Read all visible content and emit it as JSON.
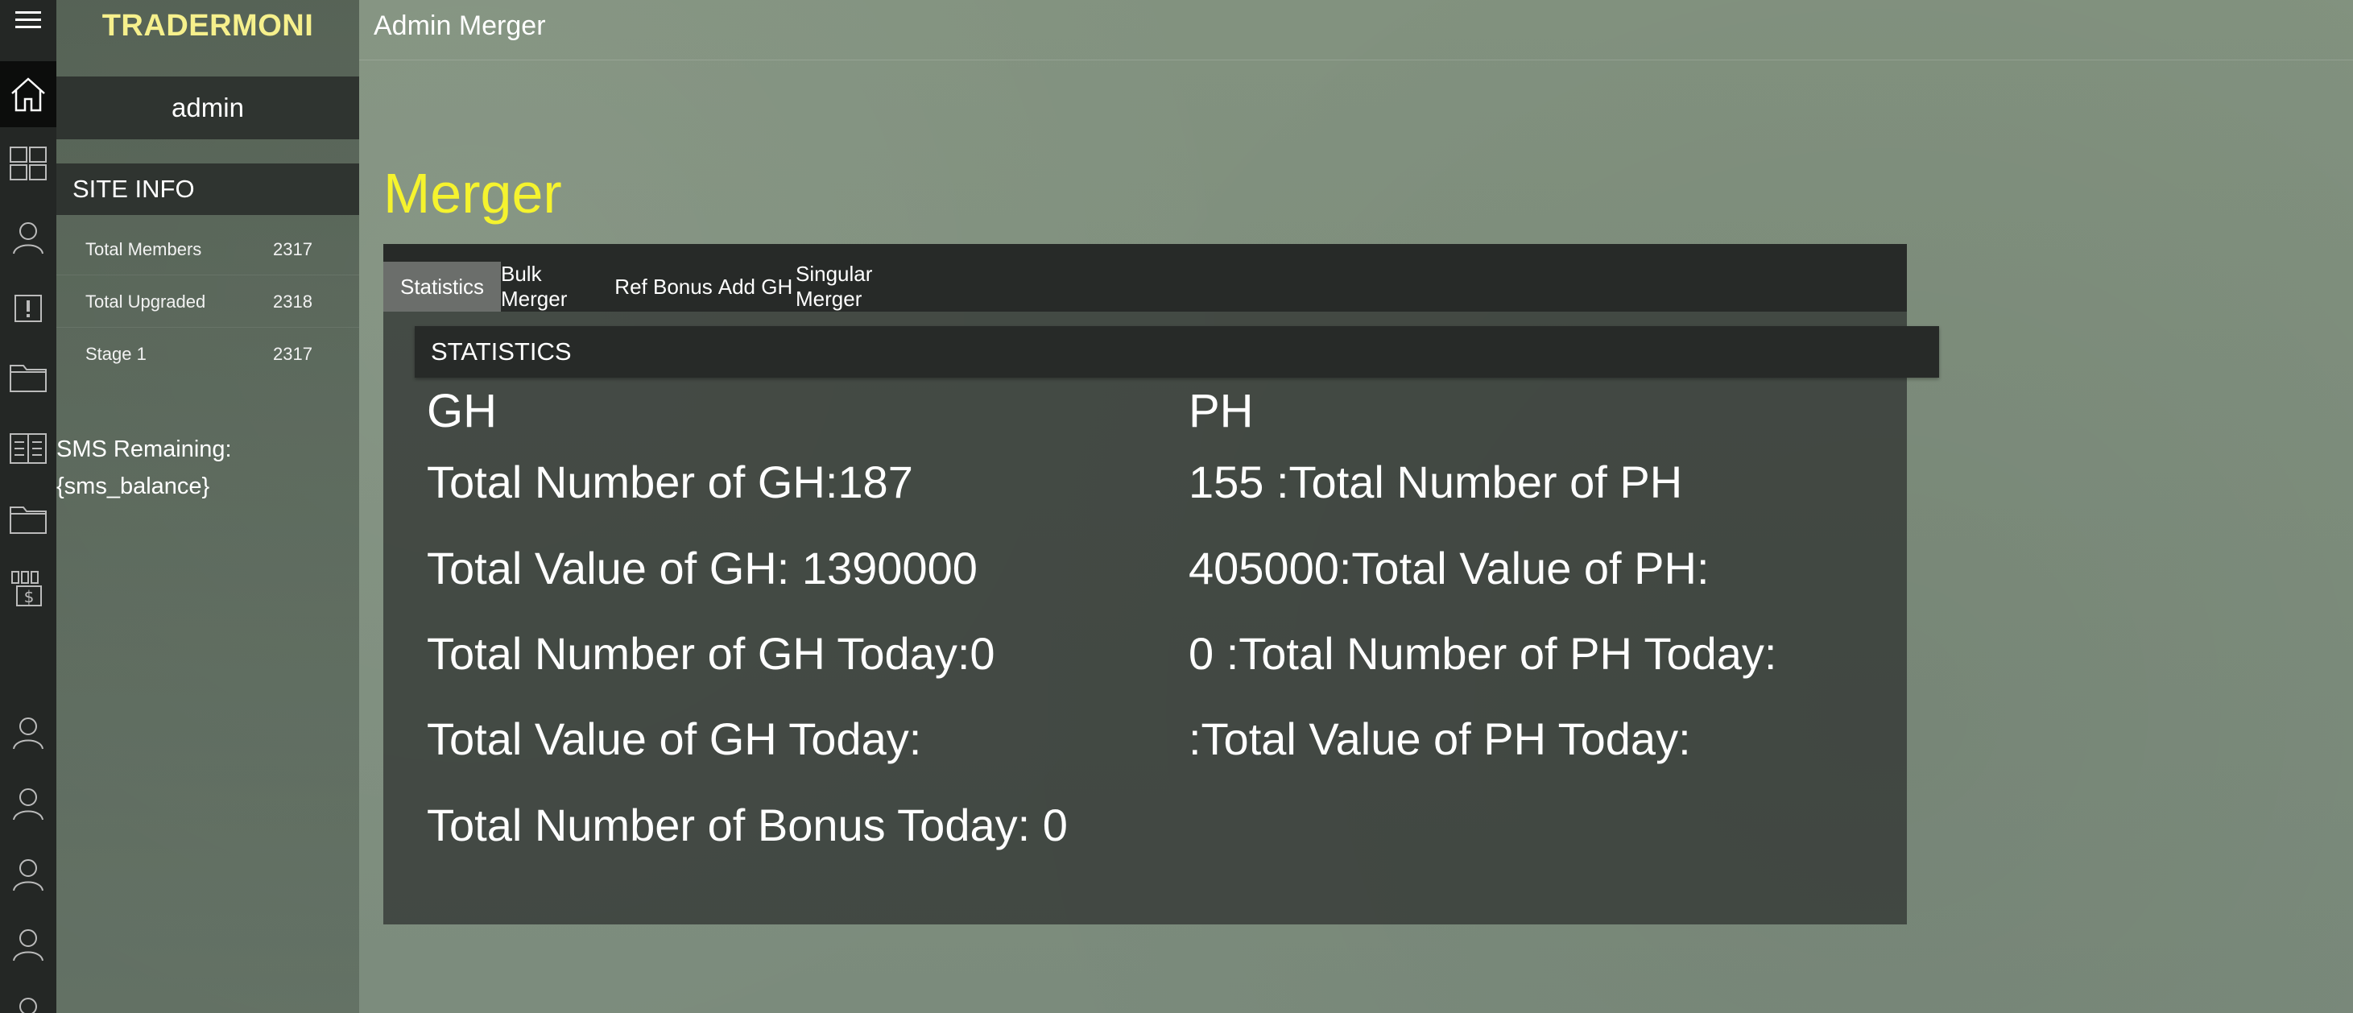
{
  "brand": "TRADERMONI",
  "topbar": {
    "title": "Admin Merger"
  },
  "sidebar": {
    "user": "admin",
    "site_info_title": "SITE INFO",
    "stats": [
      {
        "label": "Total Members",
        "value": "2317"
      },
      {
        "label": "Total Upgraded",
        "value": "2318"
      },
      {
        "label": "Stage 1",
        "value": "2317"
      }
    ],
    "sms_label": "SMS Remaining:",
    "sms_value": "{sms_balance}"
  },
  "rail_icons": [
    "menu-icon",
    "home-icon",
    "dashboard-icon",
    "user-icon",
    "alert-icon",
    "folder-icon",
    "list-icon",
    "folder-icon",
    "payments-icon",
    "user-icon",
    "user-icon",
    "user-icon",
    "user-icon",
    "user-icon"
  ],
  "main": {
    "page_title": "Merger",
    "tabs": [
      {
        "label": "Statistics",
        "active": true
      },
      {
        "label": "Bulk Merger",
        "active": false
      },
      {
        "label": "Ref Bonus",
        "active": false
      },
      {
        "label": "Add GH",
        "active": false
      },
      {
        "label": "Singular Merger",
        "active": false
      }
    ],
    "section_title": "STATISTICS",
    "gh": {
      "heading": "GH",
      "lines": [
        "Total Number of GH:187",
        "Total Value of GH: 1390000",
        "Total Number of GH Today:0",
        "Total Value of GH Today:",
        "Total Number of Bonus Today: 0"
      ]
    },
    "ph": {
      "heading": "PH",
      "lines": [
        "155 :Total Number of PH",
        "405000:Total Value of PH:",
        "0 :Total Number of PH Today:",
        ":Total Value of PH Today:"
      ]
    }
  },
  "colors": {
    "brand": "#f6f08c",
    "page_title": "#f5f32e",
    "panel": "#323633",
    "rail": "#242725"
  }
}
